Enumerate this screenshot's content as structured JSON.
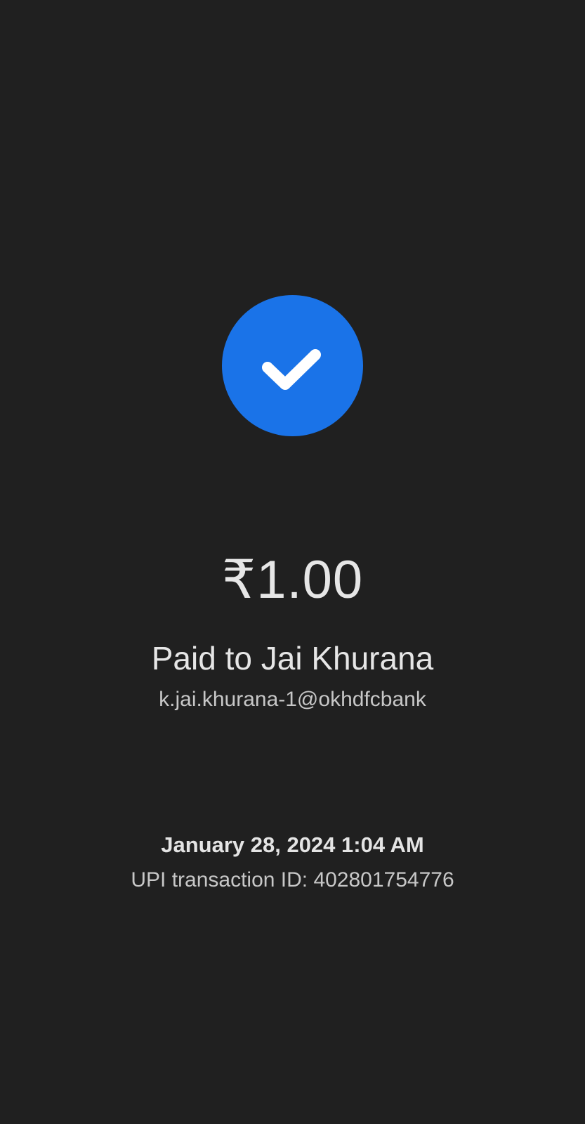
{
  "payment": {
    "status_icon": "check-icon",
    "amount": "₹1.00",
    "payee_name": "Paid to Jai Khurana",
    "payee_upi": "k.jai.khurana-1@okhdfcbank",
    "date_time": "January 28, 2024 1:04 AM",
    "transaction_id": "UPI transaction ID: 402801754776"
  },
  "colors": {
    "background": "#202020",
    "accent": "#1a73e8",
    "text_primary": "#e6e6e6",
    "text_secondary": "#c7c7c7"
  }
}
